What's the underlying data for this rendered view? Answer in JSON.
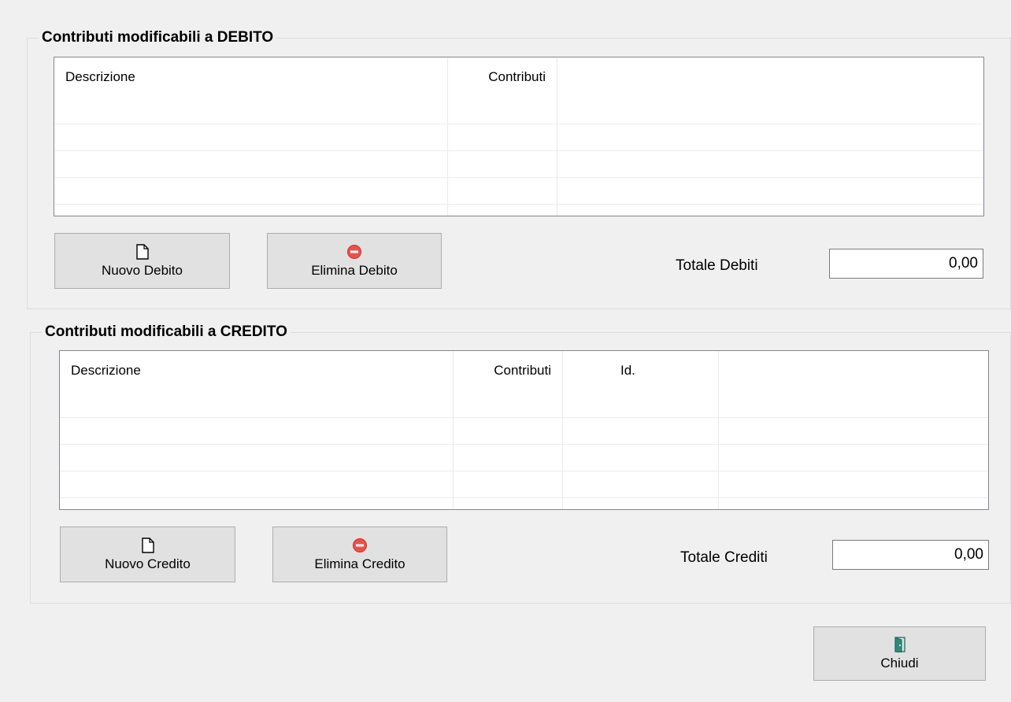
{
  "debito": {
    "title": "Contributi modificabili a DEBITO",
    "columns": [
      "Descrizione",
      "Contributi"
    ],
    "new_button": "Nuovo Debito",
    "delete_button": "Elimina Debito",
    "total_label": "Totale Debiti",
    "total_value": "0,00"
  },
  "credito": {
    "title": "Contributi modificabili a CREDITO",
    "columns": [
      "Descrizione",
      "Contributi",
      "Id."
    ],
    "new_button": "Nuovo Credito",
    "delete_button": "Elimina Credito",
    "total_label": "Totale Crediti",
    "total_value": "0,00"
  },
  "close_button": "Chiudi",
  "icons": {
    "new": "new-document-icon",
    "delete": "delete-red-circle-icon",
    "close": "exit-door-icon"
  },
  "colors": {
    "window_bg": "#f0f0f0",
    "button_bg": "#e1e1e1",
    "delete_icon": "#e8524a",
    "door_icon": "#2e8b7a"
  }
}
